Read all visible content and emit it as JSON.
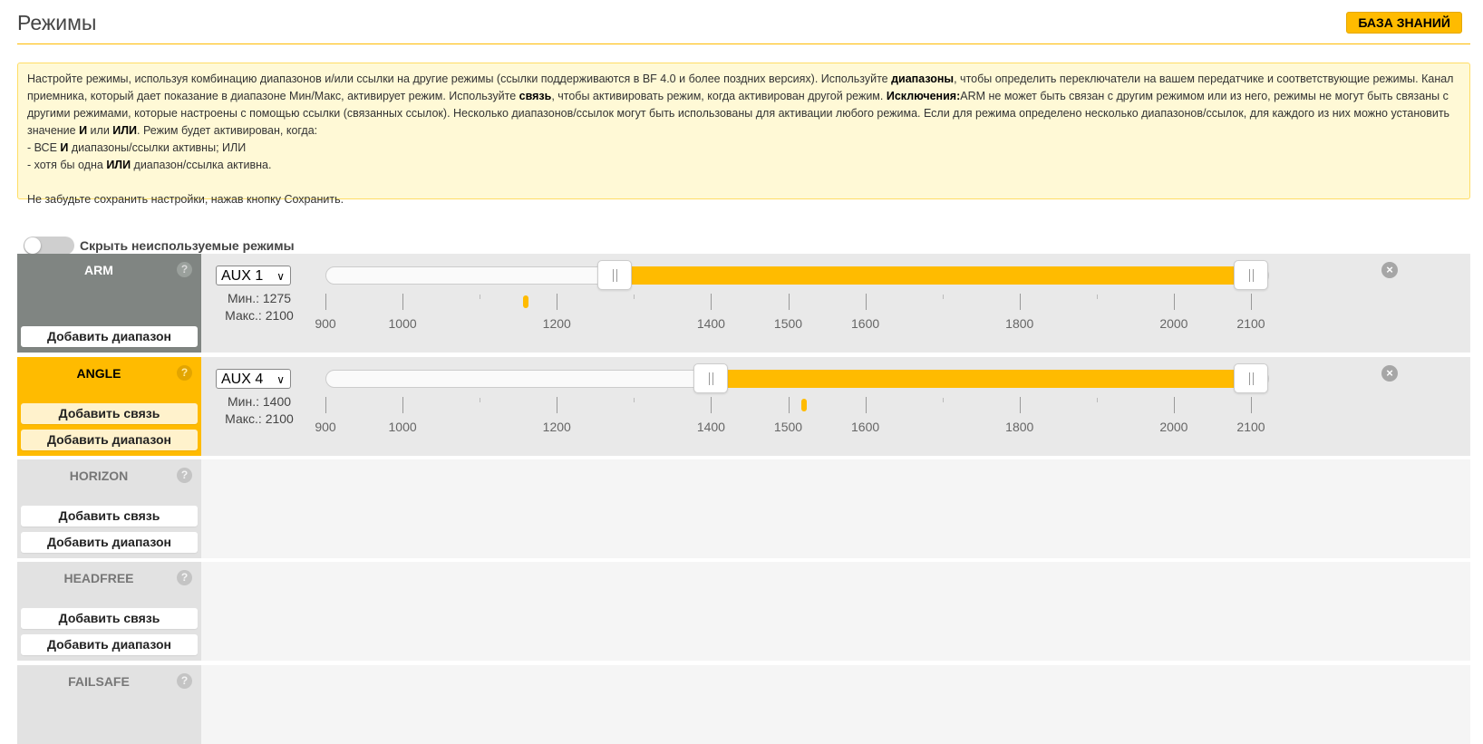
{
  "header": {
    "title": "Режимы",
    "wiki_label": "БАЗА ЗНАНИЙ"
  },
  "note": {
    "p1_a": "Настройте режимы, используя комбинацию диапазонов и/или ссылки на другие режимы (ссылки поддерживаются в BF 4.0 и более поздних версиях). Используйте ",
    "p1_b": "диапазоны",
    "p1_c": ", чтобы определить переключатели на вашем передатчике и соответствующие режимы. Канал приемника, который дает показание в диапазоне Мин/Макс, активирует режим. Используйте ",
    "p1_d": "связь",
    "p1_e": ", чтобы активировать режим, когда активирован другой режим. ",
    "p1_f": "Исключения:",
    "p1_g": "ARM не может быть связан с другим режимом или из него, режимы не могут быть связаны с другими режимами, которые настроены с помощью ссылки (связанных ссылок). Несколько диапазонов/ссылок могут быть использованы для активации любого режима. Если для режима определено несколько диапазонов/ссылок, для каждого из них можно установить значение ",
    "p1_h": "И",
    "p1_i": " или ",
    "p1_j": "ИЛИ",
    "p1_k": ". Режим будет активирован, когда:",
    "l1_a": "- ВСЕ ",
    "l1_b": "И",
    "l1_c": " диапазоны/ссылки активны; ИЛИ",
    "l2_a": "- хотя бы одна ",
    "l2_b": "ИЛИ",
    "l2_c": " диапазон/ссылка активна.",
    "p2": "Не забудьте сохранить настройки, нажав кнопку Сохранить."
  },
  "toggle": {
    "label": "Скрыть неиспользуемые режимы",
    "on": false
  },
  "scale": {
    "min": 900,
    "max": 2100,
    "labels": [
      900,
      1000,
      1200,
      1400,
      1500,
      1600,
      1800,
      2000,
      2100
    ],
    "minor_ticks": [
      1100,
      1300,
      1700,
      1900
    ]
  },
  "modes": [
    {
      "name": "ARM",
      "help": "?",
      "aux": "AUX 1",
      "min_label": "Мин.: 1275",
      "max_label": "Макс.: 2100",
      "range_min": 1275,
      "range_max": 2100,
      "current": 1160,
      "add_link": null,
      "add_range": "Добавить диапазон",
      "close": "×"
    },
    {
      "name": "ANGLE",
      "help": "?",
      "aux": "AUX 4",
      "min_label": "Мин.: 1400",
      "max_label": "Макс.: 2100",
      "range_min": 1400,
      "range_max": 2100,
      "current": 1520,
      "add_link": "Добавить связь",
      "add_range": "Добавить диапазон",
      "close": "×"
    },
    {
      "name": "HORIZON",
      "help": "?",
      "add_link": "Добавить связь",
      "add_range": "Добавить диапазон"
    },
    {
      "name": "HEADFREE",
      "help": "?",
      "add_link": "Добавить связь",
      "add_range": "Добавить диапазон"
    },
    {
      "name": "FAILSAFE",
      "help": "?"
    }
  ],
  "colors": {
    "accent": "#ffbb00",
    "arm_bg": "#808582"
  }
}
